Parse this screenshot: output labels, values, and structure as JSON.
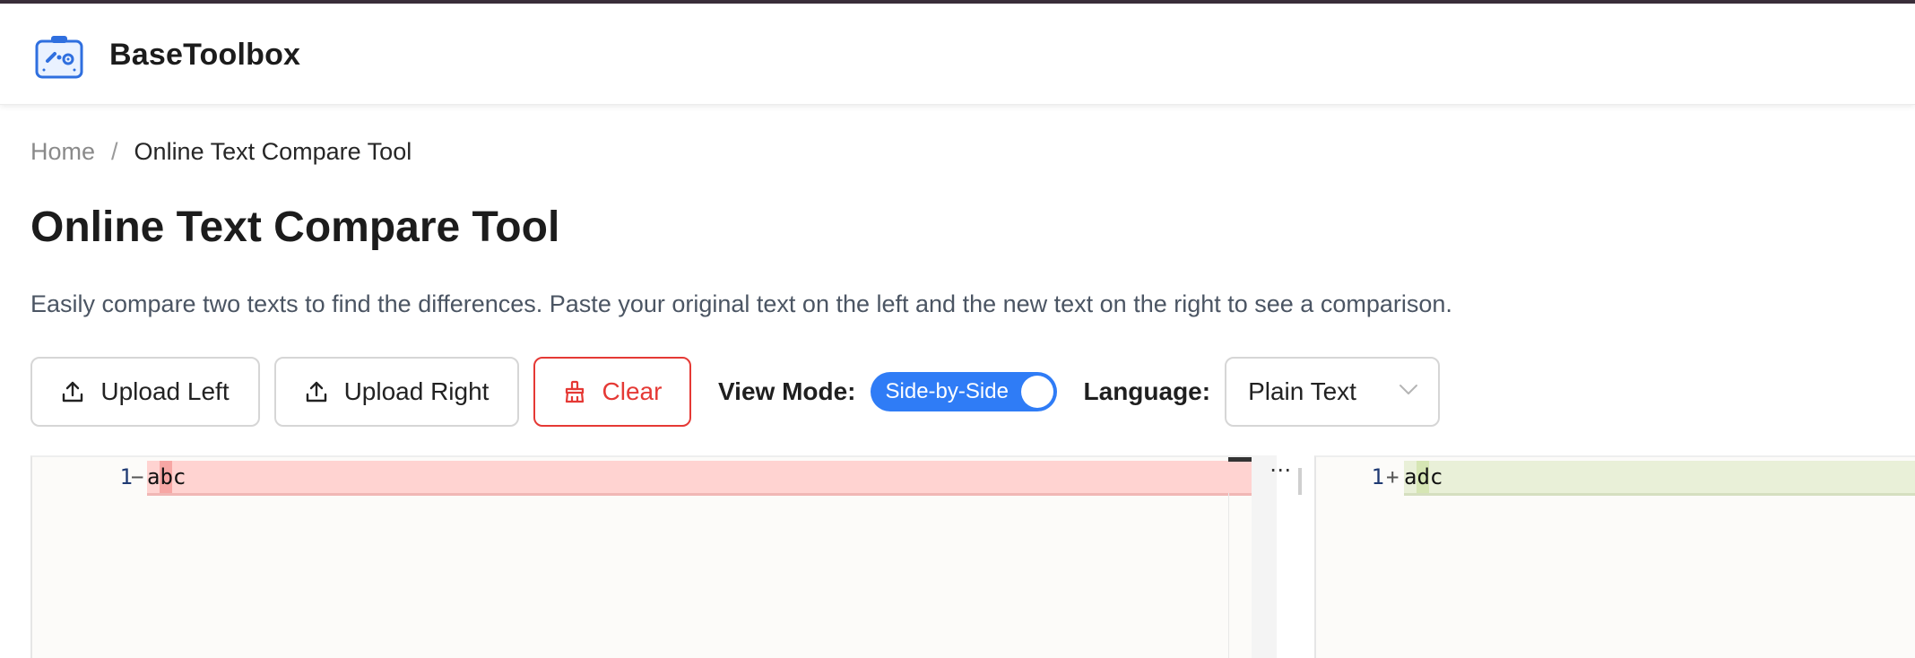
{
  "app": {
    "brand": "BaseToolbox",
    "accent_color": "#2f7cf6",
    "danger_color": "#e53935"
  },
  "breadcrumb": {
    "home": "Home",
    "separator": "/",
    "current": "Online Text Compare Tool"
  },
  "page": {
    "title": "Online Text Compare Tool",
    "description": "Easily compare two texts to find the differences. Paste your original text on the left and the new text on the right to see a comparison."
  },
  "toolbar": {
    "upload_left_label": "Upload Left",
    "upload_right_label": "Upload Right",
    "clear_label": "Clear",
    "view_mode_label": "View Mode:",
    "view_mode_value": "Side-by-Side",
    "language_label": "Language:",
    "language_value": "Plain Text"
  },
  "diff": {
    "left": {
      "line_number": "1",
      "sign": "−",
      "text": "abc"
    },
    "gutter_icon": "⋯",
    "right": {
      "line_number": "1",
      "sign": "+",
      "text": "adc"
    }
  }
}
